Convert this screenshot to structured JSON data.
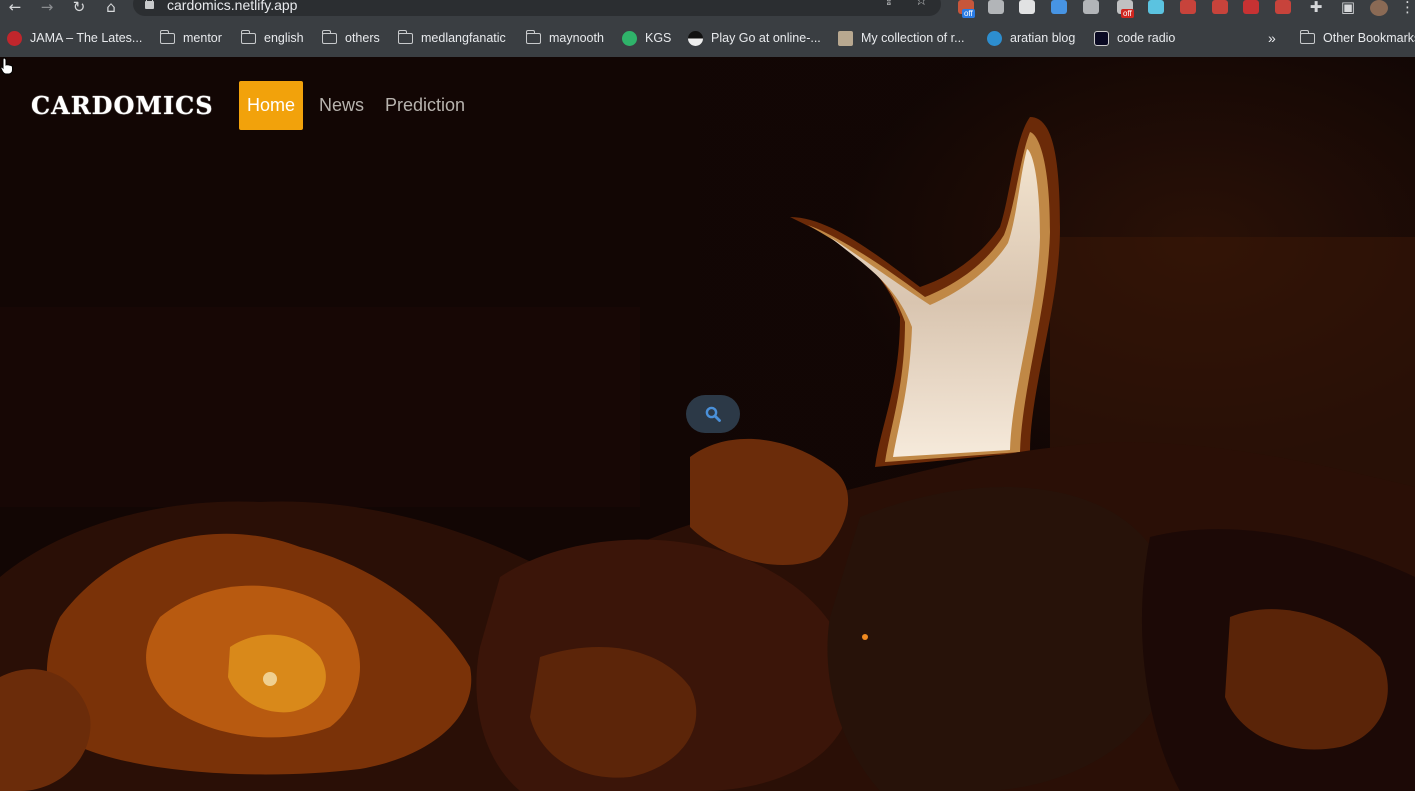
{
  "browser": {
    "url": "cardomics.netlify.app",
    "extensions": [
      {
        "name": "extension-a",
        "badge": "off",
        "color": "#e05a3a"
      },
      {
        "name": "extension-b",
        "color": "#c8cacc"
      },
      {
        "name": "notion-icon",
        "color": "#ffffff"
      },
      {
        "name": "clock-icon",
        "color": "#4aa3ff"
      },
      {
        "name": "target-icon",
        "color": "#c8cacc"
      },
      {
        "name": "extension-c",
        "badge": "off",
        "color": "#d8d8d8"
      },
      {
        "name": "react-icon",
        "color": "#61dafb"
      },
      {
        "name": "extension-d",
        "color": "#e0443a"
      },
      {
        "name": "extension-e",
        "color": "#e0443a"
      },
      {
        "name": "youtube-icon",
        "color": "#e03030"
      },
      {
        "name": "extension-f",
        "color": "#e0443a"
      }
    ],
    "bookmarks": [
      {
        "label": "JAMA – The Lates...",
        "icon": "jama-icon"
      },
      {
        "label": "mentor",
        "icon": "folder-icon"
      },
      {
        "label": "english",
        "icon": "folder-icon"
      },
      {
        "label": "others",
        "icon": "folder-icon"
      },
      {
        "label": "medlangfanatic",
        "icon": "folder-icon"
      },
      {
        "label": "maynooth",
        "icon": "folder-icon"
      },
      {
        "label": "KGS",
        "icon": "kgs-icon"
      },
      {
        "label": "Play Go at online-...",
        "icon": "go-icon"
      },
      {
        "label": "My collection of r...",
        "icon": "photo-icon"
      },
      {
        "label": "aratian blog",
        "icon": "wordpress-icon"
      },
      {
        "label": "code radio",
        "icon": "code-radio-icon"
      }
    ],
    "more_bookmarks": "»",
    "other_bookmarks": "Other Bookmarks"
  },
  "site": {
    "logo": "CARDOMICS",
    "nav": [
      {
        "label": "Home",
        "active": true
      },
      {
        "label": "News",
        "active": false
      },
      {
        "label": "Prediction",
        "active": false
      }
    ],
    "colors": {
      "accent": "#f2a20b",
      "search_bg": "#2c3947",
      "search_icon": "#4a90d9"
    }
  }
}
